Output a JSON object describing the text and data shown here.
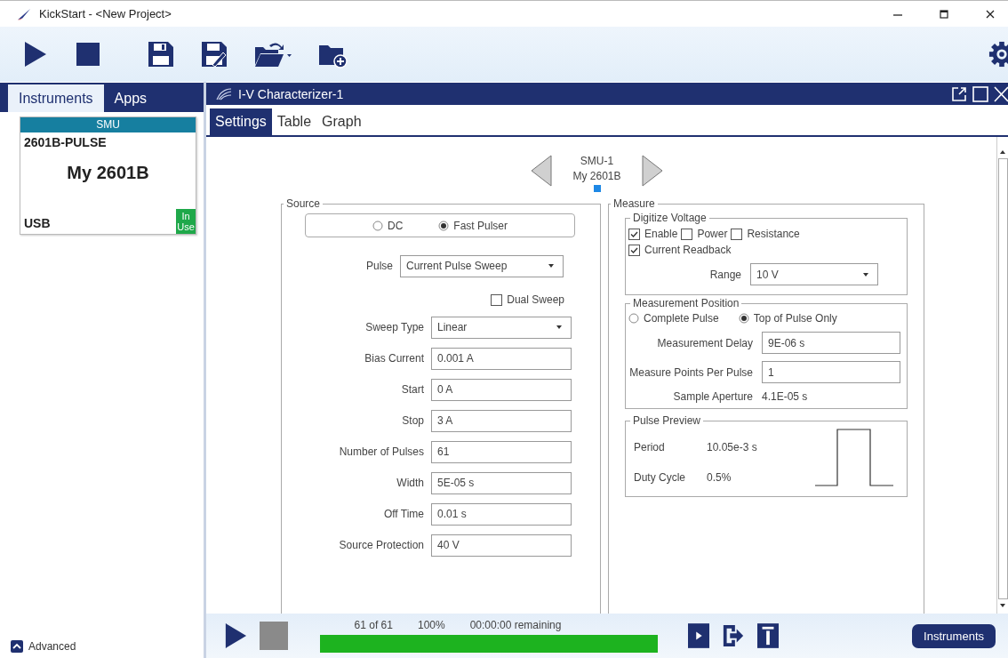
{
  "window": {
    "title": "KickStart - <New Project>"
  },
  "left_panel": {
    "tabs": [
      {
        "label": "Instruments",
        "selected": true
      },
      {
        "label": "Apps",
        "selected": false
      }
    ],
    "instrument": {
      "type": "SMU",
      "model": "2601B-PULSE",
      "name": "My 2601B",
      "connection": "USB",
      "badge": "In Use"
    },
    "advanced": "Advanced"
  },
  "app": {
    "title": "I-V Characterizer-1",
    "tabs": [
      {
        "label": "Settings",
        "selected": true
      },
      {
        "label": "Table",
        "selected": false
      },
      {
        "label": "Graph",
        "selected": false
      }
    ],
    "device": {
      "id": "SMU-1",
      "name": "My 2601B"
    },
    "source": {
      "title": "Source",
      "modes": [
        {
          "label": "DC",
          "selected": false
        },
        {
          "label": "Fast Pulser",
          "selected": true
        }
      ],
      "rows": [
        {
          "kind": "wide-select",
          "label": "Pulse",
          "value": "Current Pulse Sweep"
        },
        {
          "kind": "checkbox",
          "label": "Dual Sweep",
          "checked": false
        },
        {
          "kind": "select",
          "label": "Sweep Type",
          "value": "Linear"
        },
        {
          "kind": "input",
          "label": "Bias Current",
          "value": "0.001 A"
        },
        {
          "kind": "input",
          "label": "Start",
          "value": "0 A"
        },
        {
          "kind": "input",
          "label": "Stop",
          "value": "3 A"
        },
        {
          "kind": "input",
          "label": "Number of Pulses",
          "value": "61"
        },
        {
          "kind": "input",
          "label": "Width",
          "value": "5E-05 s"
        },
        {
          "kind": "input",
          "label": "Off Time",
          "value": "0.01 s"
        },
        {
          "kind": "input",
          "label": "Source Protection",
          "value": "40 V"
        }
      ]
    },
    "measure": {
      "title": "Measure",
      "digitize": {
        "title": "Digitize Voltage",
        "options": [
          {
            "label": "Enable",
            "checked": true
          },
          {
            "label": "Power",
            "checked": false
          },
          {
            "label": "Resistance",
            "checked": false
          }
        ],
        "readback": {
          "label": "Current Readback",
          "checked": true
        },
        "range": {
          "label": "Range",
          "value": "10 V"
        }
      },
      "position": {
        "title": "Measurement Position",
        "modes": [
          {
            "label": "Complete Pulse",
            "selected": false
          },
          {
            "label": "Top of Pulse Only",
            "selected": true
          }
        ],
        "fields": [
          {
            "label": "Measurement Delay",
            "value": "9E-06 s"
          },
          {
            "label": "Measure Points Per Pulse",
            "value": "1"
          }
        ],
        "aperture": {
          "label": "Sample Aperture",
          "value": "4.1E-05 s"
        }
      },
      "preview": {
        "title": "Pulse Preview",
        "rows": [
          {
            "label": "Period",
            "value": "10.05e-3 s"
          },
          {
            "label": "Duty Cycle",
            "value": "0.5%"
          }
        ]
      }
    }
  },
  "run_bar": {
    "count": "61 of 61",
    "percent": "100%",
    "remaining": "00:00:00 remaining",
    "level": 1.0,
    "instruments_button": "Instruments"
  }
}
